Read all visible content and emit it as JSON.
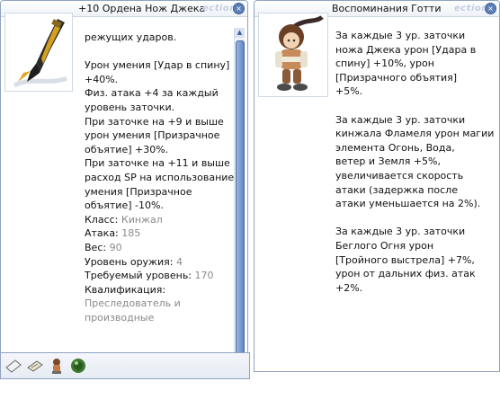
{
  "left": {
    "title": "+10 Ордена Нож Джека",
    "title_ghost": "ections",
    "lines": [
      {
        "t": "режущих ударов."
      },
      {
        "t": ""
      },
      {
        "t": "Урон умения [Удар в спину]"
      },
      {
        "t": "+40%."
      },
      {
        "t": "Физ. атака +4 за каждый"
      },
      {
        "t": "уровень заточки."
      },
      {
        "t": "При заточке на +9 и выше"
      },
      {
        "t": "урон умения [Призрачное"
      },
      {
        "t": "объятие] +30%."
      },
      {
        "t": "При заточке на +11 и выше"
      },
      {
        "t": "расход SP на использование"
      },
      {
        "t": "умения [Призрачное"
      },
      {
        "t": "объятие] -10%."
      }
    ],
    "props": [
      {
        "label": "Класс:",
        "value": "Кинжал"
      },
      {
        "label": "Атака:",
        "value": "185"
      },
      {
        "label": "Вес:",
        "value": "90"
      },
      {
        "label": "Уровень оружия:",
        "value": "4"
      },
      {
        "label": "Требуемый уровень:",
        "value": "170"
      },
      {
        "label": "Квалификация:",
        "value": ""
      }
    ],
    "qual_lines": [
      "Преследователь и",
      "производные"
    ]
  },
  "right": {
    "title": "Воспоминания Готти",
    "title_ghost": "ections",
    "lines": [
      "За каждые 3 ур. заточки",
      "ножа Джека урон [Удара в",
      "спину] +10%, урон",
      "[Призрачного объятия]",
      "+5%.",
      "",
      "За каждые 3 ур. заточки",
      "кинжала Фламеля урон магии",
      "элемента Огонь, Вода,",
      "ветер и Земля +5%,",
      "увеличивается скорость",
      "атаки (задержка после",
      "атаки уменьшается на 2%).",
      "",
      "За каждые 3 ур. заточки",
      "Беглого Огня урон",
      "[Тройного выстрела] +7%,",
      "урон от дальних физ. атак",
      "+2%."
    ]
  },
  "colors": {
    "accent": "#5b7fb8",
    "border": "#8fa4c2",
    "gray_value": "#8a8a8a"
  },
  "icons": [
    "dagger-icon",
    "doll-icon",
    "card-icon",
    "scroll-icon",
    "doll-slot-icon",
    "orb-icon",
    "close-icon"
  ]
}
